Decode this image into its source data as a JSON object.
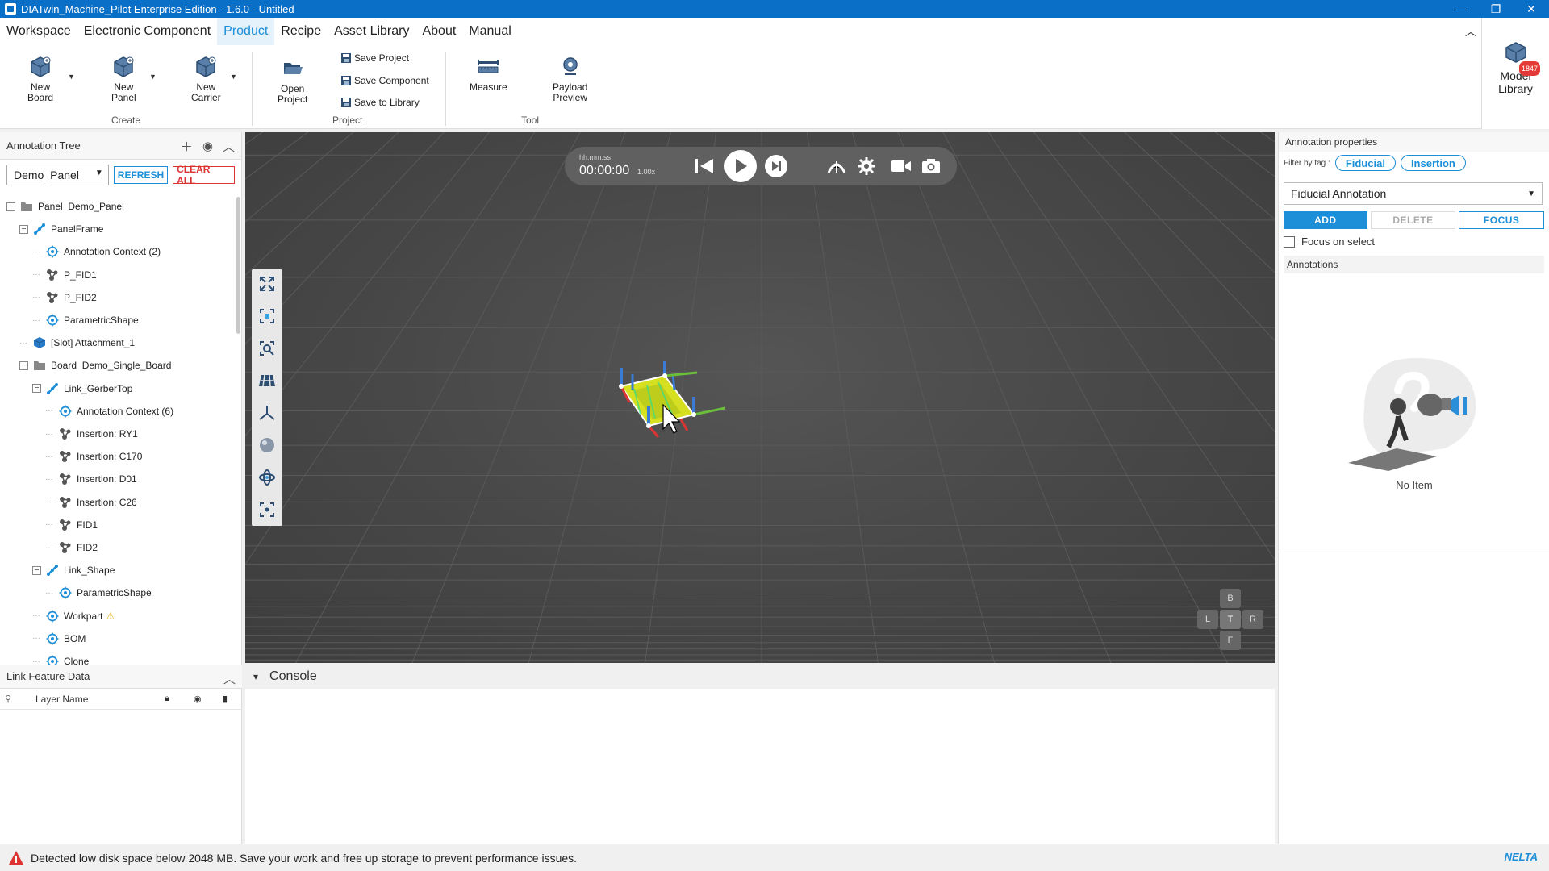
{
  "window": {
    "title": "DIATwin_Machine_Pilot Enterprise Edition - 1.6.0 - Untitled",
    "controls": {
      "minimize": "—",
      "restore": "❐",
      "close": "✕"
    }
  },
  "menu": {
    "items": [
      "Workspace",
      "Electronic Component",
      "Product",
      "Recipe",
      "Asset Library",
      "About",
      "Manual"
    ],
    "active": "Product"
  },
  "ribbon": {
    "create": {
      "label": "Create",
      "new_board": "New\nBoard",
      "new_panel": "New\nPanel",
      "new_carrier": "New\nCarrier"
    },
    "project": {
      "label": "Project",
      "open_project": "Open\nProject",
      "save_project": "Save Project",
      "save_component": "Save Component",
      "save_to_library": "Save to Library"
    },
    "tool": {
      "label": "Tool",
      "measure": "Measure",
      "payload_preview": "Payload\nPreview"
    }
  },
  "model_library": {
    "label": "Model\nLibrary",
    "badge": "1847"
  },
  "annotation_tree": {
    "title": "Annotation Tree",
    "selected_panel": "Demo_Panel",
    "refresh_label": "REFRESH",
    "clear_label": "CLEAR ALL",
    "items": [
      {
        "label": "Panel  Demo_Panel",
        "icon": "folder-icon",
        "toggle": "−"
      },
      {
        "label": "PanelFrame",
        "icon": "link-icon",
        "toggle": "−"
      },
      {
        "label": "Annotation Context (2)",
        "icon": "context-icon"
      },
      {
        "label": "P_FID1",
        "icon": "fiducial-icon"
      },
      {
        "label": "P_FID2",
        "icon": "fiducial-icon"
      },
      {
        "label": "ParametricShape",
        "icon": "context-icon"
      },
      {
        "label": "[Slot] Attachment_1",
        "icon": "cube-icon"
      },
      {
        "label": "Board  Demo_Single_Board",
        "icon": "folder-icon",
        "toggle": "−"
      },
      {
        "label": "Link_GerberTop",
        "icon": "link-icon",
        "toggle": "−"
      },
      {
        "label": "Annotation Context (6)",
        "icon": "context-icon"
      },
      {
        "label": "Insertion: RY1",
        "icon": "fiducial-icon"
      },
      {
        "label": "Insertion: C170",
        "icon": "fiducial-icon"
      },
      {
        "label": "Insertion: D01",
        "icon": "fiducial-icon"
      },
      {
        "label": "Insertion: C26",
        "icon": "fiducial-icon"
      },
      {
        "label": "FID1",
        "icon": "fiducial-icon"
      },
      {
        "label": "FID2",
        "icon": "fiducial-icon"
      },
      {
        "label": "Link_Shape",
        "icon": "link-icon",
        "toggle": "−"
      },
      {
        "label": "ParametricShape",
        "icon": "context-icon"
      },
      {
        "label": "Workpart",
        "icon": "context-icon",
        "warning": "⚠"
      },
      {
        "label": "BOM",
        "icon": "context-icon"
      },
      {
        "label": "Clone",
        "icon": "context-icon"
      }
    ]
  },
  "link_feature": {
    "title": "Link Feature Data",
    "columns": [
      "Layer Name"
    ]
  },
  "playback": {
    "time_format": "hh:mm:ss",
    "time": "00:00:00",
    "speed": "1.00x"
  },
  "navcube": {
    "top": "B",
    "left": "L",
    "center": "T",
    "right": "R",
    "bottom": "F"
  },
  "console": {
    "title": "Console"
  },
  "annotation_properties": {
    "title": "Annotation properties",
    "filter_label": "Filter by tag :",
    "tags": [
      "Fiducial",
      "Insertion"
    ],
    "selected_type": "Fiducial Annotation",
    "add_label": "ADD",
    "delete_label": "DELETE",
    "focus_label": "FOCUS",
    "focus_on_select": "Focus on select",
    "annotations_header": "Annotations",
    "empty_text": "No Item"
  },
  "status": {
    "message": "Detected low disk space below 2048 MB. Save your work and free up storage to prevent performance issues.",
    "brand": "NELTA"
  },
  "colors": {
    "accent": "#1d8fd8",
    "titlebar": "#0a6fc7",
    "danger": "#d33",
    "viewport": "#484848"
  }
}
